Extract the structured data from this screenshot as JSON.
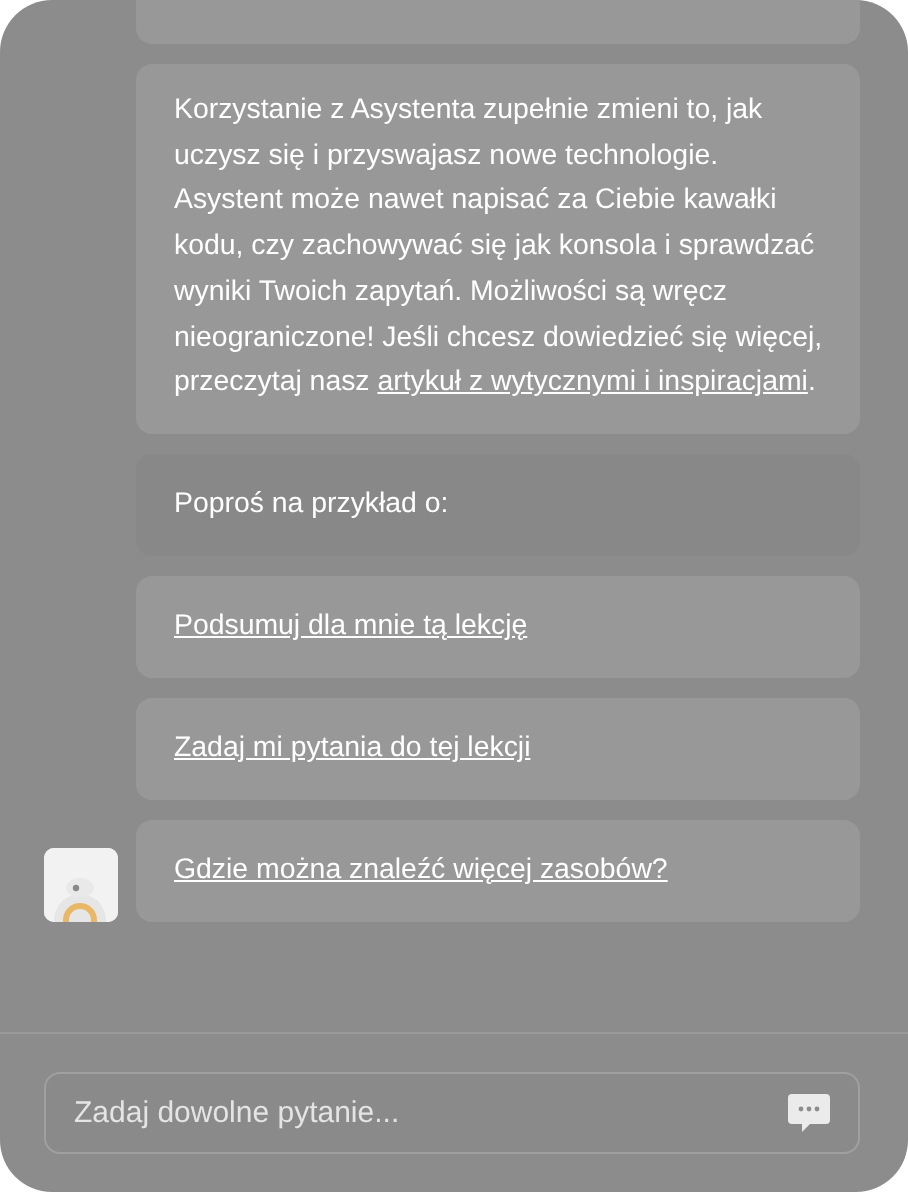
{
  "messages": [
    {
      "kind": "cut"
    },
    {
      "kind": "text",
      "before": "Korzystanie z Asystenta zupełnie zmieni to, jak uczysz się i przyswajasz nowe technologie. Asystent może nawet napisać za Ciebie kawałki kodu, czy zachowywać się jak konsola i sprawdzać wyniki Twoich zapytań. Możliwości są wręcz nieograniczone! Jeśli chcesz dowiedzieć się więcej, przeczytaj nasz ",
      "link": "artykuł z wytycznymi i inspiracjami",
      "after": "."
    }
  ],
  "prompt_label": "Poproś na przykład o:",
  "suggestions": [
    "Podsumuj dla mnie tą lekcję",
    "Zadaj mi pytania do tej lekcji",
    "Gdzie można znaleźć więcej zasobów?"
  ],
  "input": {
    "placeholder": "Zadaj dowolne pytanie..."
  }
}
